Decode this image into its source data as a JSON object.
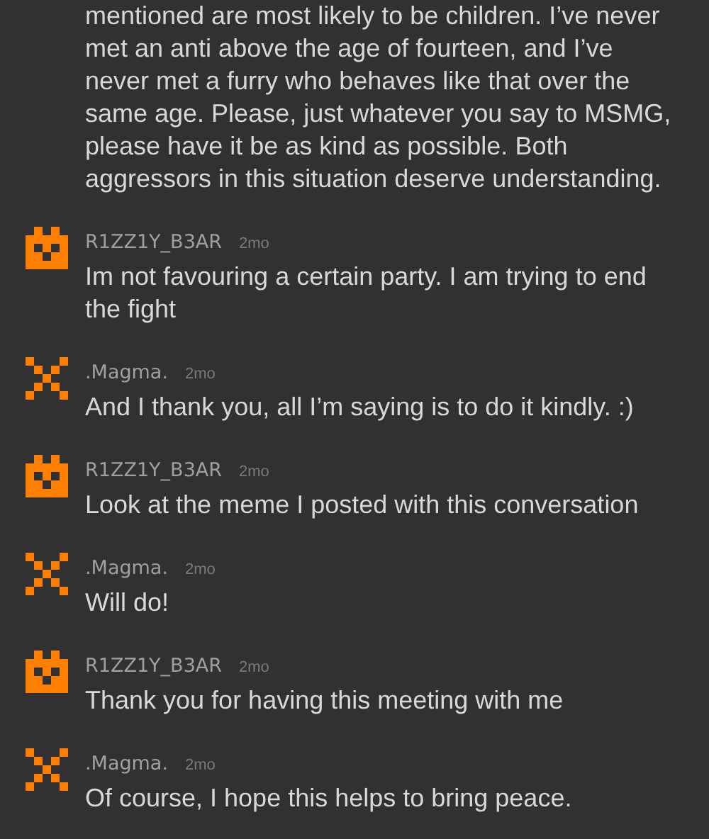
{
  "previous_comment_text": "mentioned are most likely to be children. I’ve never met an anti above the age of fourteen, and I’ve never met a furry who behaves like that over the same age. Please, just whatever you say to MSMG, please have it be as kind as possible. Both aggressors in this situation deserve understanding.",
  "comments": [
    {
      "kind": "bear",
      "username": "R1ZZ1Y_B3AR",
      "time": "2mo",
      "text": "Im not favouring a certain party. I am trying to end the fight"
    },
    {
      "kind": "cross",
      "username": ".Magma.",
      "time": "2mo",
      "text": "And I thank you, all I’m saying is to do it kindly. :)"
    },
    {
      "kind": "bear",
      "username": "R1ZZ1Y_B3AR",
      "time": "2mo",
      "text": "Look at the meme I posted with this conversation"
    },
    {
      "kind": "cross",
      "username": ".Magma.",
      "time": "2mo",
      "text": "Will do!"
    },
    {
      "kind": "bear",
      "username": "R1ZZ1Y_B3AR",
      "time": "2mo",
      "text": "Thank you for having this meeting with me"
    },
    {
      "kind": "cross",
      "username": ".Magma.",
      "time": "2mo",
      "text": "Of course, I hope this helps to bring peace."
    }
  ]
}
